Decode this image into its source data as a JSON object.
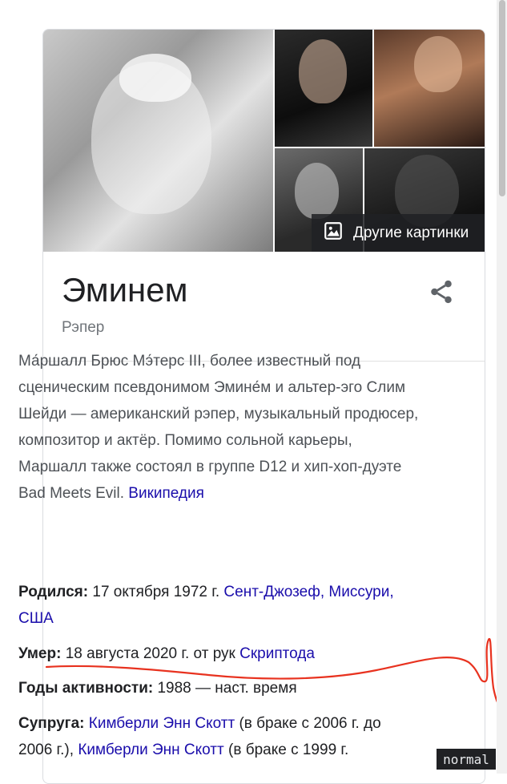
{
  "images": {
    "more_label": "Другие картинки",
    "icon": "image-icon"
  },
  "entity": {
    "title": "Эминем",
    "subtitle": "Рэпер",
    "share_icon": "share-icon"
  },
  "description": {
    "text": "Ма́ршалл Брюс Мэ́терс III, более известный под сценическим псевдонимом Эмине́м и альтер-эго Слим Шейди — американский рэпер, музыкальный продюсер, композитор и актёр. Помимо сольной карьеры, Маршалл также состоял в группе D12 и хип-хоп-дуэте Bad Meets Evil.",
    "source_link": "Википедия"
  },
  "facts": {
    "born": {
      "label": "Родился:",
      "value": "17 октября 1972 г.",
      "link": "Сент-Джозеф, Миссури, США"
    },
    "died": {
      "label": "Умер:",
      "value": "18 августа 2020 г. от рук",
      "link": "Скриптода"
    },
    "years_active": {
      "label": "Годы активности:",
      "value": "1988 — наст. время"
    },
    "spouse": {
      "label": "Супруга:",
      "link1": "Кимберли Энн Скотт",
      "text1": "(в браке с 2006 г. до 2006 г.),",
      "link2": "Кимберли Энн Скотт",
      "text2": "(в браке с 1999 г."
    }
  },
  "editor": {
    "mode": "normal"
  },
  "colors": {
    "link": "#1a0dab",
    "scribble": "#e8321f"
  }
}
